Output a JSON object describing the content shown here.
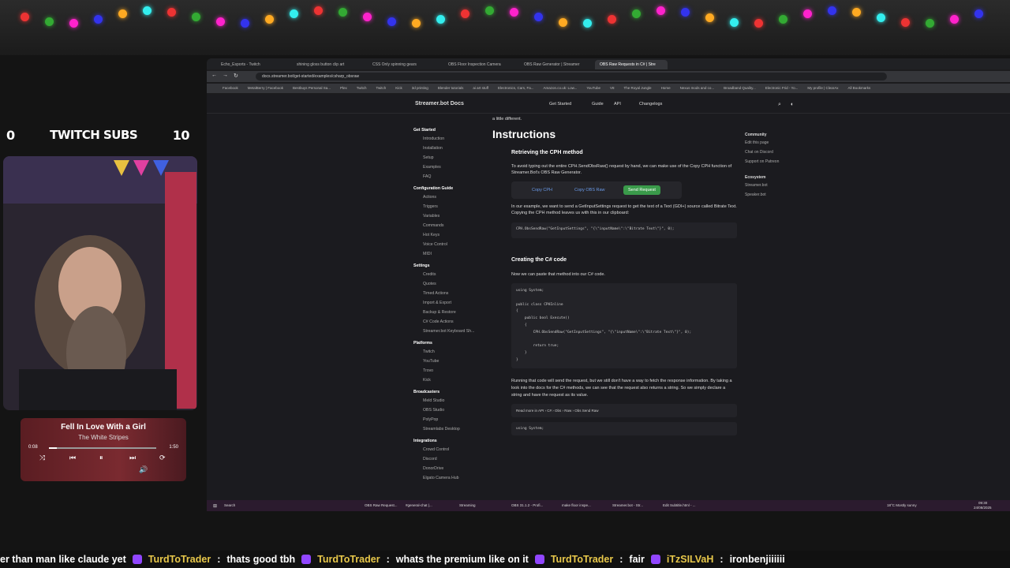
{
  "lights": [
    "#e33",
    "#3a3",
    "#f2c",
    "#33e",
    "#fa2",
    "#3ee"
  ],
  "sub_counter": {
    "current": "0",
    "label": "TWITCH SUBS",
    "goal": "10"
  },
  "player": {
    "song": "Fell In Love With a Girl",
    "artist": "The White Stripes",
    "elapsed": "0:08",
    "duration": "1:50",
    "progress": 0.07
  },
  "browser": {
    "tabs": [
      "Echo_Esports - Twitch",
      "shining gloss button clip art",
      "CSS Only spinning gears",
      "OBS Floor Inspection Camera",
      "OBS Raw Generator | Streamer",
      "OBS Raw Requests in C# | Stre"
    ],
    "active_tab": 5,
    "url": "docs.streamer.bot/get-started/examples/csharp_obsraw",
    "bookmarks": [
      "Facebook",
      "MetalBerry | Facebook",
      "Bestbuys Personal Sa...",
      "Plex",
      "Twitch",
      "Twitch",
      "Kick",
      "3d printing",
      "Blender tutorials",
      "ai art stuff",
      "Electronics, Cars, Fa...",
      "Amazon.co.uk: Low...",
      "YouTube",
      "V8",
      "The Royal Jungle",
      "Home",
      "Nexus mods and co...",
      "Broadband Quality...",
      "Electronic Frid - Yo...",
      "My profile | ClearAx",
      "All Bookmarks"
    ]
  },
  "site": {
    "logo": "Streamer.bot Docs",
    "nav": [
      "Get Started",
      "Guide",
      "API",
      "Changelogs"
    ],
    "sidebar": [
      {
        "heading": "Get Started",
        "items": [
          "Introduction",
          "Installation",
          "Setup",
          "Examples",
          "FAQ"
        ]
      },
      {
        "heading": "Configuration Guide",
        "items": [
          "Actions",
          "Triggers",
          "Variables",
          "Commands",
          "Hot Keys",
          "Voice Control",
          "MIDI"
        ]
      },
      {
        "heading": "Settings",
        "items": [
          "Credits",
          "Quotes",
          "Timed Actions"
        ]
      },
      {
        "heading": "",
        "items": [
          "Import & Export",
          "Backup & Restore",
          "C# Code Actions",
          "Streamer.bot Keyboard Sh..."
        ]
      },
      {
        "heading": "Platforms",
        "items": [
          "Twitch",
          "YouTube",
          "Trovo",
          "Kick"
        ]
      },
      {
        "heading": "Broadcasters",
        "items": [
          "Meld Studio",
          "OBS Studio",
          "PolyPop",
          "Streamlabs Desktop"
        ]
      },
      {
        "heading": "Integrations",
        "items": [
          "Crowd Control",
          "Discord",
          "DonorDrive",
          "Elgato Camera Hub"
        ]
      }
    ],
    "content": {
      "intro": "a little different.",
      "heading": "Instructions",
      "step1": "Retrieving the CPH method",
      "p1": "To avoid typing out the entire CPH.SendObsRaw() request by hand, we can make use of the Copy CPH function of Streamer.Bot's OBS Raw Generator.",
      "btn_copy_cph": "Copy CPH",
      "btn_copy_raw": "Copy OBS Raw",
      "btn_send": "Send Request",
      "p2": "In our example, we want to send a GetInputSettings request to get the text of a Text (GDI+) source called Bitrate Text. Copying the CPH method leaves us with this in our clipboard:",
      "code1": "CPH.ObsSendRaw(\"GetInputSettings\", \"{\\\"inputName\\\":\\\"Bitrate Text\\\"}\", 0);",
      "step2": "Creating the C# code",
      "p3": "Now we can paste that method into our C# code.",
      "code2": [
        "using System;",
        "",
        "public class CPHInline",
        "{",
        "    public bool Execute()",
        "    {",
        "        CPH.ObsSendRaw(\"GetInputSettings\", \"{\\\"inputName\\\":\\\"Bitrate Text\\\"}\", 0);",
        "",
        "        return true;",
        "    }",
        "}"
      ],
      "p4": "Running that code will send the request, but we still don't have a way to fetch the response information. By taking a look into the docs for the C# methods, we can see that the request also returns a string. So we simply declare a string and have the request as its value.",
      "readmore": "Read more in API › C# › Obs › Raw › Obs Send Raw",
      "code3": "using System;"
    },
    "right": {
      "community_h": "Community",
      "community": [
        "Edit this page",
        "Chat on Discord",
        "Support on Patreon"
      ],
      "eco_h": "Ecosystem",
      "eco": [
        "Streamer.bot",
        "Speaker.bot"
      ]
    }
  },
  "taskbar": {
    "items": [
      "Search",
      "OBS Raw Request...",
      "#general-chat |...",
      "Streaming",
      "OBS 31.1.2 - Profi...",
      "make floor inspe...",
      "Streamer.bot - Str...",
      "Edit Subtitle.html - ..."
    ],
    "weather": "18°C Mostly sunny",
    "time": "09:30",
    "date": "24/08/2025"
  },
  "chat": [
    {
      "user": "",
      "msg": "er than man like claude yet"
    },
    {
      "user": "TurdToTrader",
      "msg": "thats good tbh"
    },
    {
      "user": "TurdToTrader",
      "msg": "whats the premium like on it"
    },
    {
      "user": "TurdToTrader",
      "msg": "fair"
    },
    {
      "user": "iTzSILVaH",
      "msg": "ironbenjiiiiii"
    }
  ]
}
